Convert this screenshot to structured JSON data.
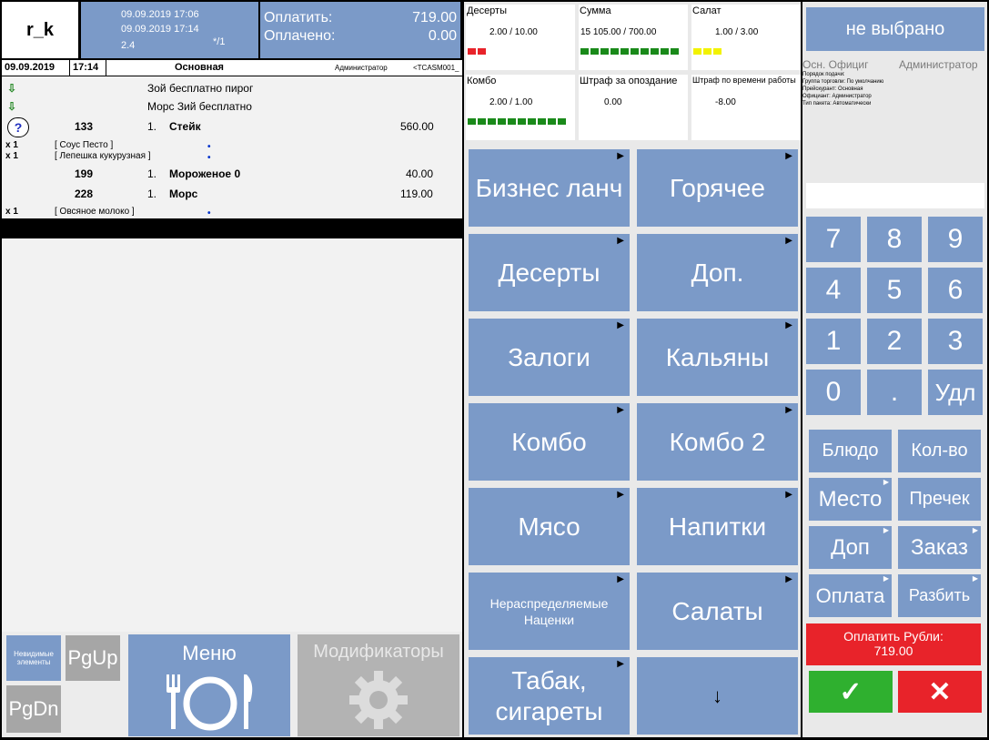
{
  "header": {
    "logo": "r_k",
    "time1": "09.09.2019 17:06",
    "time2": "09.09.2019 17:14",
    "version": "2.4",
    "guests": "*/1",
    "pay_label": "Оплатить:",
    "pay_value": "719.00",
    "paid_label": "Оплачено:",
    "paid_value": "0.00"
  },
  "order": {
    "date": "09.09.2019",
    "time": "17:14",
    "menu": "Основная",
    "waiter": "Администратор",
    "station": "<TCASM001_",
    "free1": "Зой бесплатно пирог",
    "free2": "Морс Зий бесплатно",
    "items": [
      {
        "code": "133",
        "qty": "1.",
        "name": "Стейк",
        "price": "560.00"
      },
      {
        "code": "199",
        "qty": "1.",
        "name": "Мороженое 0",
        "price": "40.00"
      },
      {
        "code": "228",
        "qty": "1.",
        "name": "Морс",
        "price": "119.00"
      }
    ],
    "mods": [
      {
        "qty": "x 1",
        "name": "[ Соус Песто ]"
      },
      {
        "qty": "x 1",
        "name": "[ Лепешка кукурузная ]"
      },
      {
        "qty": "x 1",
        "name": "[ Овсяное молоко ]"
      }
    ]
  },
  "bottom": {
    "invisible": "Невидимые элементы",
    "pgup": "PgUp",
    "pgdn": "PgDn",
    "menu": "Меню",
    "modifiers": "Модификаторы"
  },
  "stats": [
    {
      "title": "Десерты",
      "value": "2.00 / 10.00",
      "bars": "red",
      "count": 2
    },
    {
      "title": "Сумма",
      "value": "15 105.00 / 700.00",
      "bars": "green",
      "count": 10
    },
    {
      "title": "Салат",
      "value": "1.00 / 3.00",
      "bars": "yellow",
      "count": 3
    },
    {
      "title": "Комбо",
      "value": "2.00 / 1.00",
      "bars": "green",
      "count": 10
    },
    {
      "title": "Штраф за опоздание",
      "value": "0.00",
      "bars": "",
      "count": 0
    },
    {
      "title": "Штраф по времени работы",
      "value": "-8.00",
      "bars": "",
      "count": 0
    }
  ],
  "categories": [
    "Бизнес ланч",
    "Горячее",
    "Десерты",
    "Доп.",
    "Залоги",
    "Кальяны",
    "Комбо",
    "Комбо 2",
    "Мясо",
    "Напитки",
    "Нераспределяемые Наценки",
    "Салаты",
    "Табак, сигареты",
    "↓"
  ],
  "right": {
    "not_selected": "не выбрано",
    "officiant_short": "Осн. Официг",
    "admin": "Администратор",
    "info1": "Порядок подачи:",
    "info2": "Группа торговли: По умолчанию",
    "info3": "Прейскурант: Основная",
    "info4": "Официант: Администратор",
    "info5": "Тип пакета: Автоматически",
    "keys": [
      "7",
      "8",
      "9",
      "4",
      "5",
      "6",
      "1",
      "2",
      "3",
      "0",
      ".",
      "Удл"
    ],
    "actions": [
      "Блюдо",
      "Кол-во",
      "Место",
      "Пречек",
      "Доп",
      "Заказ",
      "Оплата",
      "Разбить"
    ],
    "pay_line1": "Оплатить Рубли:",
    "pay_line2": "719.00",
    "ok": "✓",
    "cancel": "✕"
  },
  "colors": {
    "blue": "#7b9ac8",
    "grey": "#a6a6a6",
    "red": "#e8232a",
    "green": "#2fb02f",
    "yellow": "#f2f200",
    "barGreen": "#1a8a1a"
  }
}
